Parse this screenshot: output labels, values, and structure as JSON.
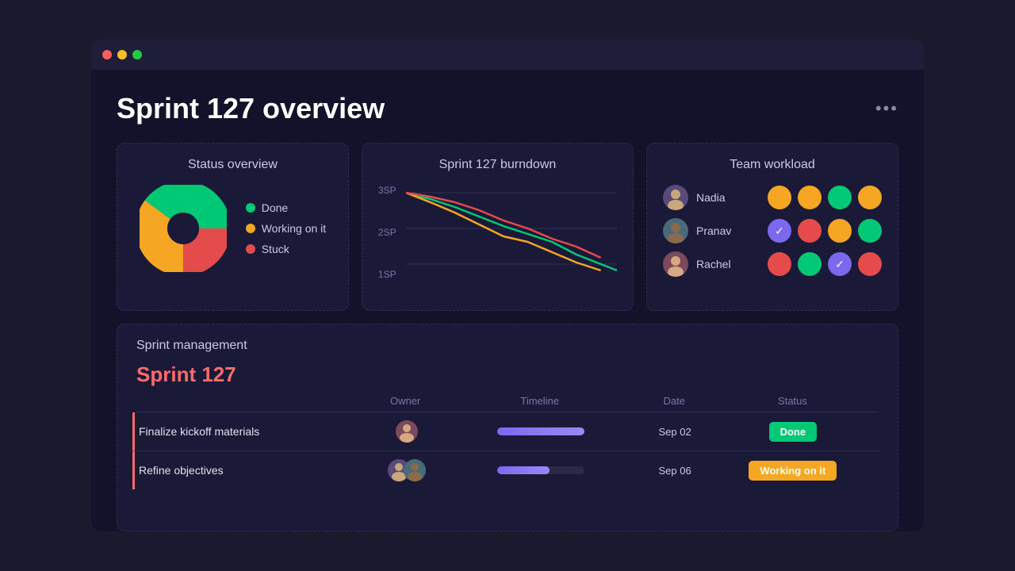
{
  "window": {
    "titlebar_dots": [
      "red",
      "yellow",
      "green"
    ]
  },
  "header": {
    "title": "Sprint 127 overview",
    "more_button": "•••"
  },
  "status_overview": {
    "title": "Status overview",
    "legend": [
      {
        "label": "Done",
        "color": "#00c875"
      },
      {
        "label": "Working on it",
        "color": "#f5a623"
      },
      {
        "label": "Stuck",
        "color": "#e44b4b"
      }
    ]
  },
  "burndown": {
    "title": "Sprint 127 burndown",
    "y_labels": [
      "3SP",
      "2SP",
      "1SP"
    ]
  },
  "team_workload": {
    "title": "Team workload",
    "members": [
      {
        "name": "Nadia",
        "dots": [
          "orange",
          "orange",
          "green",
          "orange"
        ]
      },
      {
        "name": "Pranav",
        "dots": [
          "check-purple",
          "red",
          "orange",
          "green"
        ]
      },
      {
        "name": "Rachel",
        "dots": [
          "red",
          "green",
          "check-purple",
          "red"
        ]
      }
    ]
  },
  "sprint_management": {
    "title": "Sprint management",
    "sprint_label": "Sprint 127",
    "columns": [
      "",
      "Owner",
      "Timeline",
      "Date",
      "Status",
      ""
    ],
    "tasks": [
      {
        "name": "Finalize kickoff materials",
        "owner": "single",
        "date": "Sep 02",
        "status": "Done",
        "status_type": "done",
        "timeline_full": true
      },
      {
        "name": "Refine objectives",
        "owner": "double",
        "date": "Sep 06",
        "status": "Working on it",
        "status_type": "working",
        "timeline_full": false
      }
    ]
  }
}
